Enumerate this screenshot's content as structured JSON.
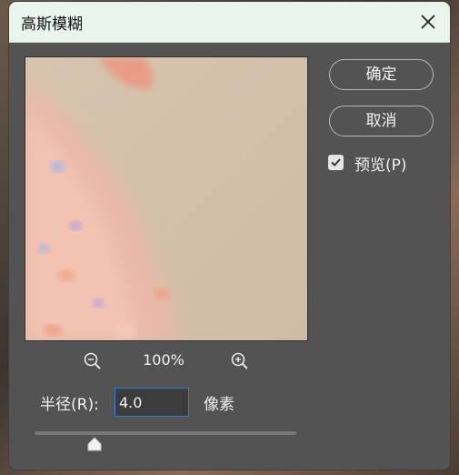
{
  "dialog": {
    "title": "高斯模糊",
    "ok_label": "确定",
    "cancel_label": "取消",
    "preview_checkbox": {
      "label": "预览(P)",
      "checked": true
    },
    "zoom": {
      "level": "100%"
    },
    "radius": {
      "label": "半径(R):",
      "value": "4.0",
      "unit": "像素"
    },
    "slider": {
      "fraction": 0.23
    }
  },
  "icons": {
    "close": "close-icon",
    "zoom_out": "zoom-out-icon",
    "zoom_in": "zoom-in-icon",
    "checkmark": "checkmark-icon",
    "slider_thumb": "slider-thumb-icon"
  },
  "colors": {
    "dialog_bg": "#535353",
    "titlebar_bg": "#eaf4ee",
    "input_border": "#2f7fd8"
  }
}
